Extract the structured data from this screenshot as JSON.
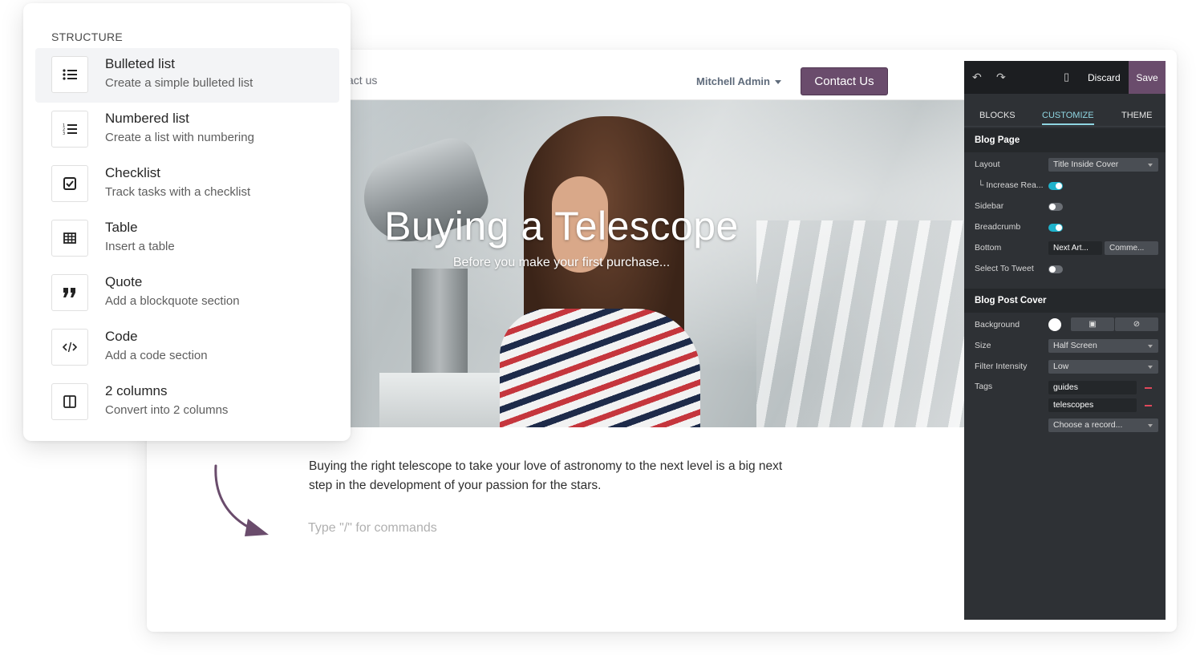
{
  "palette": {
    "header": "STRUCTURE",
    "items": [
      {
        "title": "Bulleted list",
        "description": "Create a simple bulleted list",
        "icon": "bulleted-list-icon"
      },
      {
        "title": "Numbered list",
        "description": "Create a list with numbering",
        "icon": "numbered-list-icon"
      },
      {
        "title": "Checklist",
        "description": "Track tasks with a checklist",
        "icon": "checklist-icon"
      },
      {
        "title": "Table",
        "description": "Insert a table",
        "icon": "table-icon"
      },
      {
        "title": "Quote",
        "description": "Add a blockquote section",
        "icon": "quote-icon"
      },
      {
        "title": "Code",
        "description": "Add a code section",
        "icon": "code-icon"
      },
      {
        "title": "2 columns",
        "description": "Convert into 2 columns",
        "icon": "two-columns-icon"
      }
    ]
  },
  "site": {
    "nav_partial": "act us",
    "user": "Mitchell Admin",
    "contact_button": "Contact Us",
    "cover_title": "Buying a Telescope",
    "cover_subtitle": "Before you make your first purchase...",
    "body_text": "Buying the right telescope to take your love of astronomy to the next level is a big next step in the development of your passion for the stars.",
    "command_placeholder": "Type \"/\" for commands"
  },
  "editor": {
    "discard": "Discard",
    "save": "Save",
    "tabs": [
      "BLOCKS",
      "CUSTOMIZE",
      "THEME"
    ],
    "blog_page": {
      "heading": "Blog Page",
      "layout_label": "Layout",
      "layout_value": "Title Inside Cover",
      "increase_label": "└ Increase Rea...",
      "increase_on": true,
      "sidebar_label": "Sidebar",
      "sidebar_on": false,
      "breadcrumb_label": "Breadcrumb",
      "breadcrumb_on": true,
      "bottom_label": "Bottom",
      "bottom_opt1": "Next Art...",
      "bottom_opt2": "Comme...",
      "tweet_label": "Select To Tweet",
      "tweet_on": false
    },
    "cover": {
      "heading": "Blog Post Cover",
      "background_label": "Background",
      "size_label": "Size",
      "size_value": "Half Screen",
      "filter_label": "Filter Intensity",
      "filter_value": "Low",
      "tags_label": "Tags",
      "tags": [
        "guides",
        "telescopes"
      ],
      "choose_record": "Choose a record..."
    }
  },
  "colors": {
    "brand": "#6a4c6c",
    "accent": "#1fb3cc",
    "panel_bg": "#2e3135",
    "remove": "#e0485b"
  }
}
